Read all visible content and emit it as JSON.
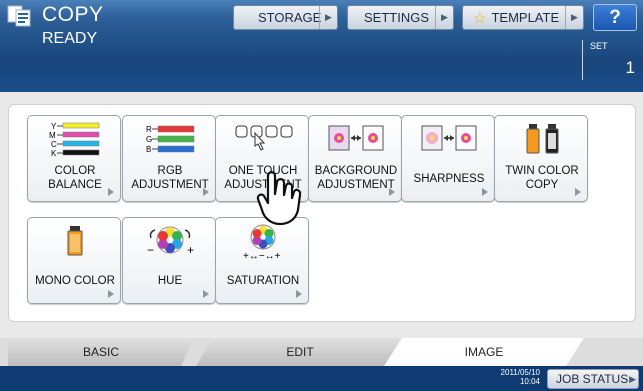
{
  "header": {
    "title": "COPY",
    "status": "READY",
    "buttons": [
      {
        "label": "STORAGE"
      },
      {
        "label": "SETTINGS"
      },
      {
        "label": "TEMPLATE"
      }
    ],
    "help_label": "?",
    "set_label": "SET",
    "set_value": "1"
  },
  "tiles": [
    {
      "label": "COLOR\nBALANCE",
      "icon": "color-balance-icon"
    },
    {
      "label": "RGB\nADJUSTMENT",
      "icon": "rgb-adjustment-icon"
    },
    {
      "label": "ONE TOUCH\nADJUSTMENT",
      "icon": "one-touch-adjustment-icon"
    },
    {
      "label": "BACKGROUND\nADJUSTMENT",
      "icon": "background-adjustment-icon"
    },
    {
      "label": "SHARPNESS",
      "icon": "sharpness-icon"
    },
    {
      "label": "TWIN COLOR\nCOPY",
      "icon": "twin-color-copy-icon"
    },
    {
      "label": "MONO COLOR",
      "icon": "mono-color-icon"
    },
    {
      "label": "HUE",
      "icon": "hue-icon"
    },
    {
      "label": "SATURATION",
      "icon": "saturation-icon"
    }
  ],
  "tabs": [
    {
      "label": "BASIC"
    },
    {
      "label": "EDIT"
    },
    {
      "label": "IMAGE",
      "selected": true
    }
  ],
  "footer": {
    "date": "2011/05/10",
    "time": "10:04",
    "job_status_label": "JOB STATUS"
  },
  "colors": {
    "header_blue": "#1a4c86",
    "footer_navy": "#0e3b72",
    "panel_bg": "#ffffff",
    "help_blue": "#1b57b0"
  }
}
